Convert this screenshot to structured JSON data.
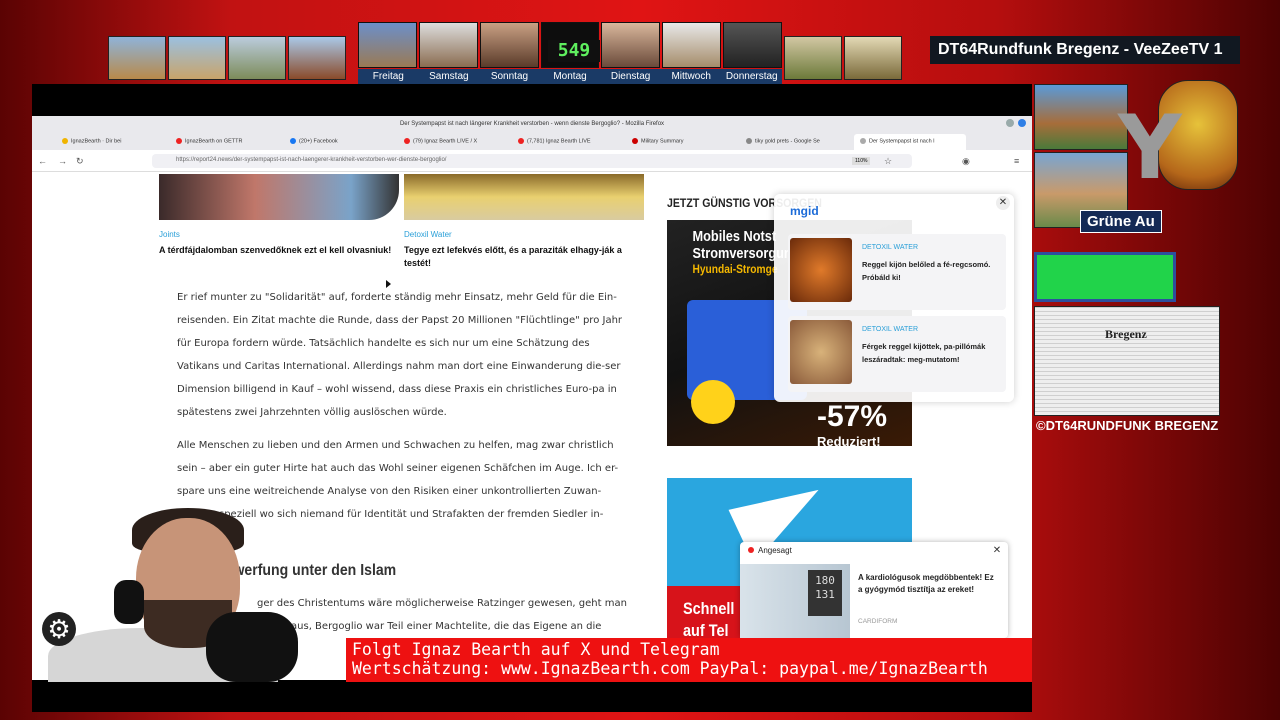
{
  "overlay": {
    "channel_title": "DT64Rundfunk Bregenz - VeeZeeTV 1",
    "counter": "549",
    "weekdays": [
      "Freitag",
      "Samstag",
      "Sonntag",
      "Montag",
      "Dienstag",
      "Mittwoch",
      "Donnerstag"
    ],
    "gruene_au": "Grüne Au",
    "etching_label": "Bregenz",
    "copyright": "©DT64RUNDFUNK BREGENZ",
    "ticker_line1": "Folgt Ignaz Bearth auf X und Telegram",
    "ticker_line2": "Wertschätzung: www.IgnazBearth.com PayPal: paypal.me/IgnazBearth"
  },
  "browser": {
    "window_title": "Der Systempapst ist nach längerer Krankheit verstorben - wenn dienste Bergoglio? - Mozilla Firefox",
    "tabs": [
      {
        "label": "IgnazBearth · Dir bei",
        "color": "#f0b400"
      },
      {
        "label": "IgnazBearth on GETTR",
        "color": "#e22"
      },
      {
        "label": "(20+) Facebook",
        "color": "#1877f2"
      },
      {
        "label": "(79) Ignaz Bearth LIVE / X",
        "color": "#e22"
      },
      {
        "label": "(7,781) Ignaz Bearth LIVE",
        "color": "#e22"
      },
      {
        "label": "Military Summary",
        "color": "#c00"
      },
      {
        "label": "tiky gold prets - Google Se",
        "color": "#888"
      },
      {
        "label": "Der Systempapst ist nach l",
        "color": "#aaa"
      }
    ],
    "url": "https://report24.news/der-systempapst-ist-nach-laengerer-krankheit-verstorben-wer-dienste-bergoglio/",
    "zoom": "110%"
  },
  "related": [
    {
      "category": "Joints",
      "title": "A térdfájdalomban szenvedőknek ezt el kell olvasniuk!"
    },
    {
      "category": "Detoxil Water",
      "title": "Tegye ezt lefekvés előtt, és a paraziták elhagy-ják a testét!"
    }
  ],
  "article": {
    "para1": "Er rief munter zu \"Solidarität\" auf, forderte ständig mehr Einsatz, mehr Geld für die Ein-reisenden. Ein Zitat machte die Runde, dass der Papst 20 Millionen \"Flüchtlinge\" pro Jahr für Europa fordern würde. Tatsächlich handelte es sich nur um eine Schätzung des Vatikans und Caritas International. Allerdings nahm man dort eine Einwanderung die-ser Dimension billigend in Kauf – wohl wissend, dass diese Praxis ein christliches Euro-pa in spätestens zwei Jahrzehnten völlig auslöschen würde.",
    "para2": "Alle Menschen zu lieben und den Armen und Schwachen zu helfen, mag zwar christlich sein – aber ein guter Hirte hat auch das Wohl seiner eigenen Schäfchen im Auge. Ich er-spare uns eine weitreichende Analyse von den Risiken einer unkontrollierten Zuwan-derung, speziell wo sich niemand für Identität und Strafakten der fremden Siedler in-",
    "heading": "rwerfung unter den Islam",
    "para3": "ger des Christentums wäre möglicherweise Ratzinger gewesen, geht man davon aus, Bergoglio war Teil einer Machtelite, die das Eigene an die ganze"
  },
  "ads": {
    "label": "JETZT GÜNSTIG VORSORGEN",
    "banner_line1": "Mobiles Notst",
    "banner_line2": "Stromversorgung",
    "banner_line3": "Hyundai-Stromge",
    "discount": "-57%",
    "reduced": "Reduziert!",
    "telegram_line1": "Schnell",
    "telegram_line2": "auf Tel"
  },
  "mgid": {
    "logo": "mgid",
    "items": [
      {
        "source": "DETOXIL WATER",
        "text": "Reggel kijön belőled a fé-regcsomó. Próbáld ki!"
      },
      {
        "source": "DETOXIL WATER",
        "text": "Férgek reggel kijöttek, pa-pillómák leszáradtak: meg-mutatom!"
      }
    ]
  },
  "angesagt": {
    "header": "Angesagt",
    "bp_values": "180 131",
    "text": "A kardiológusok megdöbbentek! Ez a gyógymód tisztítja az ereket!",
    "source": "CARDIFORM"
  },
  "colors": {
    "ticker_bg": "#ee1111",
    "link_blue": "#2a9fd8",
    "telegram_blue": "#2aa6df"
  }
}
